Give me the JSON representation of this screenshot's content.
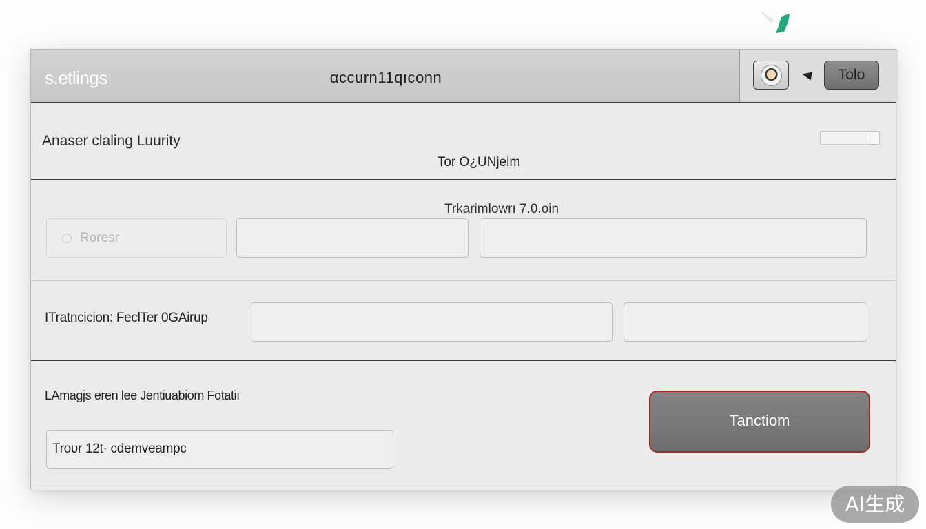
{
  "header": {
    "app_title": "s.etlings",
    "doc_title": "αccurn11qıconn",
    "tool_button": "Tolo"
  },
  "section1": {
    "label": "Anaser claling Luurity",
    "center_text": "Tor O¿UNjeim"
  },
  "section2": {
    "center_text": "Trkarimlowrı 7.0.oin",
    "ghost_placeholder": "Roresr"
  },
  "section3": {
    "label": "ITratncicion: FeclTer 0GAirup"
  },
  "section4": {
    "label": "LAmagjs eren lee Jentiuabiom Fotatiı",
    "input_value": "Troᴜr 12t· cdemveampc",
    "button_label": "Tanctiom"
  },
  "watermark": "AI生成",
  "icons": {
    "avatar": "user-avatar-icon",
    "caret": "caret-left-icon",
    "ghost": "search-icon",
    "decoration": "green-leaf-icon"
  },
  "colors": {
    "primary_button_border": "#a52b22",
    "primary_button_fill": "#777777",
    "header_divider": "#3e3e3e",
    "decoration": "#1faa7a"
  }
}
